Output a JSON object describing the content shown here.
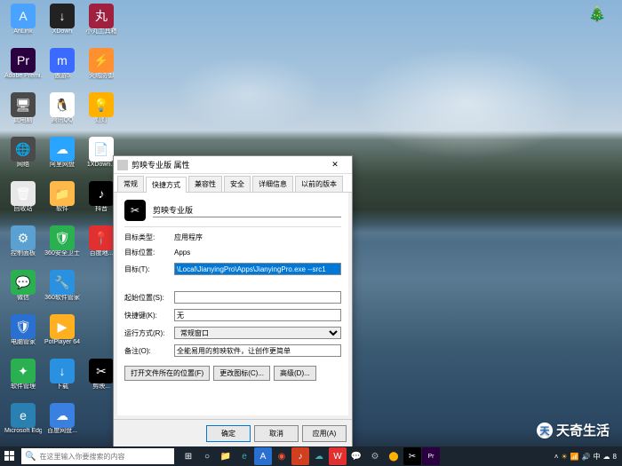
{
  "desktop_icons": [
    {
      "label": "AnLink",
      "bg": "#4aa3ff",
      "glyph": "A"
    },
    {
      "label": "XDown",
      "bg": "#222",
      "glyph": "↓"
    },
    {
      "label": "小丸工具箱",
      "bg": "#a02040",
      "glyph": "丸"
    },
    {
      "label": "",
      "bg": "transparent",
      "glyph": ""
    },
    {
      "label": "Adobe Premi...",
      "bg": "#2a0040",
      "glyph": "Pr"
    },
    {
      "label": "傲游5",
      "bg": "#3a6aff",
      "glyph": "m"
    },
    {
      "label": "火绒防御",
      "bg": "#ff9030",
      "glyph": "⚡"
    },
    {
      "label": "",
      "bg": "transparent",
      "glyph": ""
    },
    {
      "label": "此电脑",
      "bg": "#4a4a4a",
      "glyph": "🖥"
    },
    {
      "label": "腾讯QQ",
      "bg": "#fff",
      "glyph": "🐧"
    },
    {
      "label": "灯灯",
      "bg": "#ffb000",
      "glyph": "💡"
    },
    {
      "label": "",
      "bg": "transparent",
      "glyph": ""
    },
    {
      "label": "网络",
      "bg": "#4a4a4a",
      "glyph": "🌐"
    },
    {
      "label": "阿里网盘",
      "bg": "#2aa5ff",
      "glyph": "☁"
    },
    {
      "label": "1XDown...",
      "bg": "#fff",
      "glyph": "📄"
    },
    {
      "label": "",
      "bg": "transparent",
      "glyph": ""
    },
    {
      "label": "回收站",
      "bg": "#e8e8e8",
      "glyph": "🗑"
    },
    {
      "label": "软件",
      "bg": "#ffb84a",
      "glyph": "📁"
    },
    {
      "label": "抖音",
      "bg": "#000",
      "glyph": "♪"
    },
    {
      "label": "",
      "bg": "transparent",
      "glyph": ""
    },
    {
      "label": "控制面板",
      "bg": "#5aa0d0",
      "glyph": "⚙"
    },
    {
      "label": "360安全卫士",
      "bg": "#2ab050",
      "glyph": "🛡"
    },
    {
      "label": "百度地...",
      "bg": "#e03030",
      "glyph": "📍"
    },
    {
      "label": "",
      "bg": "transparent",
      "glyph": ""
    },
    {
      "label": "微信",
      "bg": "#2ab050",
      "glyph": "💬"
    },
    {
      "label": "360软件管家",
      "bg": "#2a90e0",
      "glyph": "🔧"
    },
    {
      "label": "",
      "bg": "transparent",
      "glyph": ""
    },
    {
      "label": "",
      "bg": "transparent",
      "glyph": ""
    },
    {
      "label": "电脑管家",
      "bg": "#2a70d0",
      "glyph": "🛡"
    },
    {
      "label": "PotPlayer 64",
      "bg": "#ffb020",
      "glyph": "▶"
    },
    {
      "label": "",
      "bg": "transparent",
      "glyph": ""
    },
    {
      "label": "",
      "bg": "transparent",
      "glyph": ""
    },
    {
      "label": "软件管理",
      "bg": "#2ab050",
      "glyph": "✦"
    },
    {
      "label": "下载",
      "bg": "#2a90e0",
      "glyph": "↓"
    },
    {
      "label": "剪映...",
      "bg": "#000",
      "glyph": "✂"
    },
    {
      "label": "",
      "bg": "transparent",
      "glyph": ""
    },
    {
      "label": "Microsoft Edge",
      "bg": "#2a80b0",
      "glyph": "e"
    },
    {
      "label": "百度网盘...",
      "bg": "#3a80e0",
      "glyph": "☁"
    },
    {
      "label": "",
      "bg": "transparent",
      "glyph": ""
    },
    {
      "label": "",
      "bg": "transparent",
      "glyph": ""
    }
  ],
  "dialog": {
    "title": "剪映专业版 属性",
    "tabs": [
      "常规",
      "快捷方式",
      "兼容性",
      "安全",
      "详细信息",
      "以前的版本"
    ],
    "active_tab": 1,
    "app_name": "剪映专业版",
    "fields": {
      "target_type_label": "目标类型:",
      "target_type": "应用程序",
      "target_loc_label": "目标位置:",
      "target_loc": "Apps",
      "target_label": "目标(T):",
      "target": "\\Local\\JianyingPro\\Apps\\JianyingPro.exe --src1",
      "startin_label": "起始位置(S):",
      "startin": "",
      "shortcut_label": "快捷键(K):",
      "shortcut": "无",
      "runmode_label": "运行方式(R):",
      "runmode": "常规窗口",
      "comment_label": "备注(O):",
      "comment": "全能易用的剪映软件，让创作更简单"
    },
    "button_openloc": "打开文件所在的位置(F)",
    "button_changeicon": "更改图标(C)...",
    "button_advanced": "高级(D)...",
    "button_ok": "确定",
    "button_cancel": "取消",
    "button_apply": "应用(A)"
  },
  "taskbar": {
    "search_placeholder": "在这里输入你要搜索的内容",
    "time": "8"
  },
  "watermark": "天奇生活"
}
